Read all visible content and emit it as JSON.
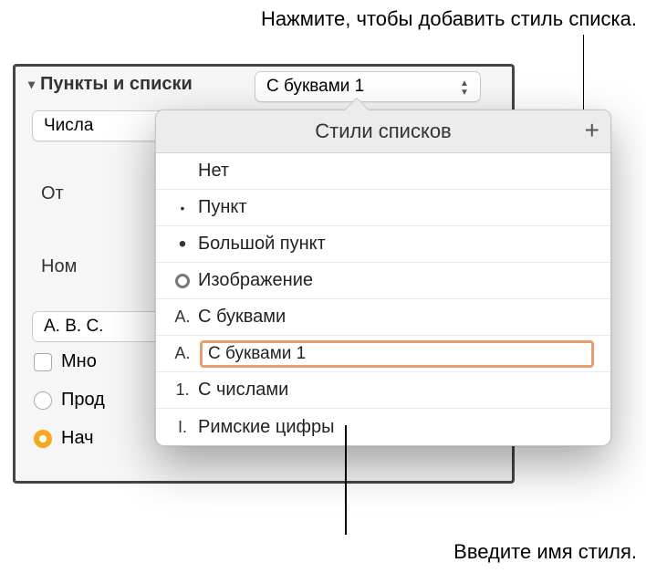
{
  "annotations": {
    "top": "Нажмите, чтобы добавить стиль списка.",
    "bottom": "Введите имя стиля."
  },
  "sidebar": {
    "section_label": "Пункты и списки",
    "disclosure": "▾",
    "dropdown_value": "С буквами 1",
    "numbers_label": "Числа",
    "label_ot": "От",
    "label_nom": "Ном",
    "abc_label": "A. B. C.",
    "label_mnog": "Мно",
    "label_prod": "Прод",
    "label_nach": "Нач"
  },
  "popover": {
    "title": "Стили списков",
    "items": [
      {
        "marker": "",
        "marker_type": "none",
        "label": "Нет"
      },
      {
        "marker": "•",
        "marker_type": "dot-small",
        "label": "Пункт"
      },
      {
        "marker": "•",
        "marker_type": "dot-large",
        "label": "Большой пункт"
      },
      {
        "marker": "○",
        "marker_type": "circle",
        "label": "Изображение"
      },
      {
        "marker": "A.",
        "marker_type": "text",
        "label": "С буквами"
      },
      {
        "marker": "A.",
        "marker_type": "text",
        "label": "С буквами 1",
        "editing": true
      },
      {
        "marker": "1.",
        "marker_type": "text",
        "label": "С числами"
      },
      {
        "marker": "I.",
        "marker_type": "text",
        "label": "Римские цифры"
      }
    ]
  }
}
